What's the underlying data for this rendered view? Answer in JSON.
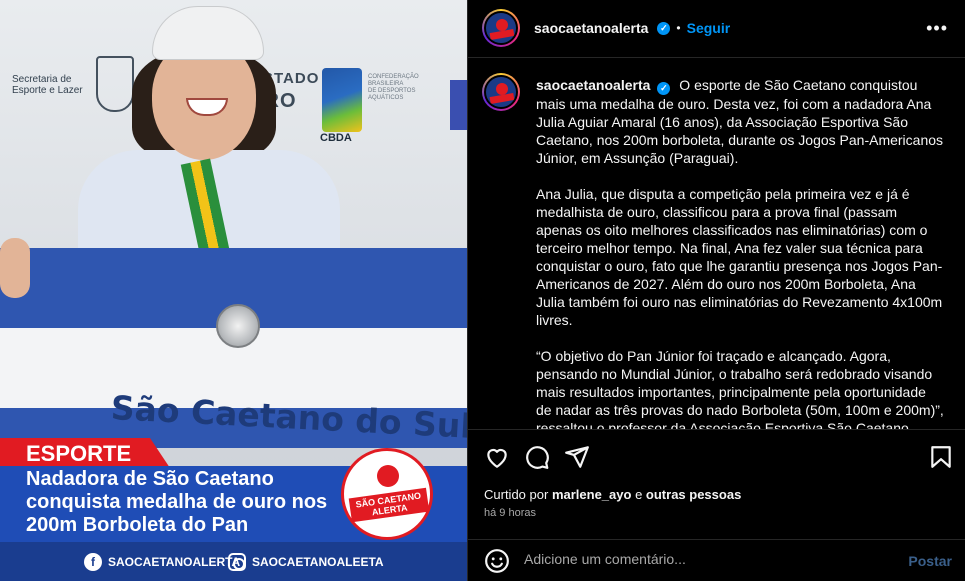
{
  "image": {
    "backdrop": {
      "logo1_line1": "Secretaria de",
      "logo1_line2": "Esporte e Lazer",
      "word_estado": "ESTADO",
      "word_iro": "IRO",
      "cbda": "CBDA",
      "cbda_small1": "CONFEDERAÇÃO",
      "cbda_small2": "BRASILEIRA",
      "cbda_small3": "DE DESPORTOS",
      "cbda_small4": "AQUÁTICOS"
    },
    "flag_text": "São Caetano do Sul",
    "tag": "ESPORTE",
    "headline": "Nadadora de São Caetano conquista medalha de ouro nos 200m Borboleta do Pan",
    "badge_text": "SÃO CAETANO ALERTA",
    "social_1": "SAOCAETANOALERTA",
    "social_2": "SAOCAETANOALEETA"
  },
  "header": {
    "username": "saocaetanoalerta",
    "separator": "•",
    "follow_label": "Seguir",
    "more_label": "•••"
  },
  "caption": {
    "username": "saocaetanoalerta",
    "p1": "O esporte de São Caetano conquistou mais uma medalha de ouro. Desta vez, foi com a nadadora Ana Julia Aguiar Amaral (16 anos), da Associação Esportiva São Caetano, nos 200m borboleta, durante os Jogos Pan-Americanos Júnior, em Assunção (Paraguai).",
    "p2": "Ana Julia, que disputa a competição pela primeira vez e já é medalhista de ouro, classificou para a prova final (passam apenas os oito melhores classificados nas eliminatórias) com o terceiro melhor tempo. Na final, Ana fez valer sua técnica para conquistar o ouro, fato que lhe garantiu presença nos Jogos Pan-Americanos de 2027. Além do ouro nos 200m Borboleta, Ana Julia também foi ouro nas eliminatórias do Revezamento 4x100m livres.",
    "p3": "“O objetivo do Pan Júnior foi traçado e alcançado. Agora, pensando no Mundial Júnior, o trabalho será redobrado visando mais resultados importantes, principalmente pela oportunidade de nadar as três provas do nado Borboleta (50m, 100m e 200m)”, ressaltou o professor da Associação Esportiva São Caetano"
  },
  "engagement": {
    "liked_prefix": "Curtido por",
    "liked_user": "marlene_ayo",
    "liked_and": "e",
    "liked_others": "outras pessoas",
    "time_ago": "há 9 horas"
  },
  "comment": {
    "placeholder": "Adicione um comentário...",
    "post_label": "Postar"
  },
  "colors": {
    "accent": "#0095f6",
    "brand_red": "#e11b22",
    "brand_blue": "#1f4db6",
    "background": "#000000"
  },
  "icons": [
    "heart-icon",
    "comment-icon",
    "share-icon",
    "bookmark-icon",
    "emoji-icon",
    "verified-icon",
    "more-icon"
  ]
}
